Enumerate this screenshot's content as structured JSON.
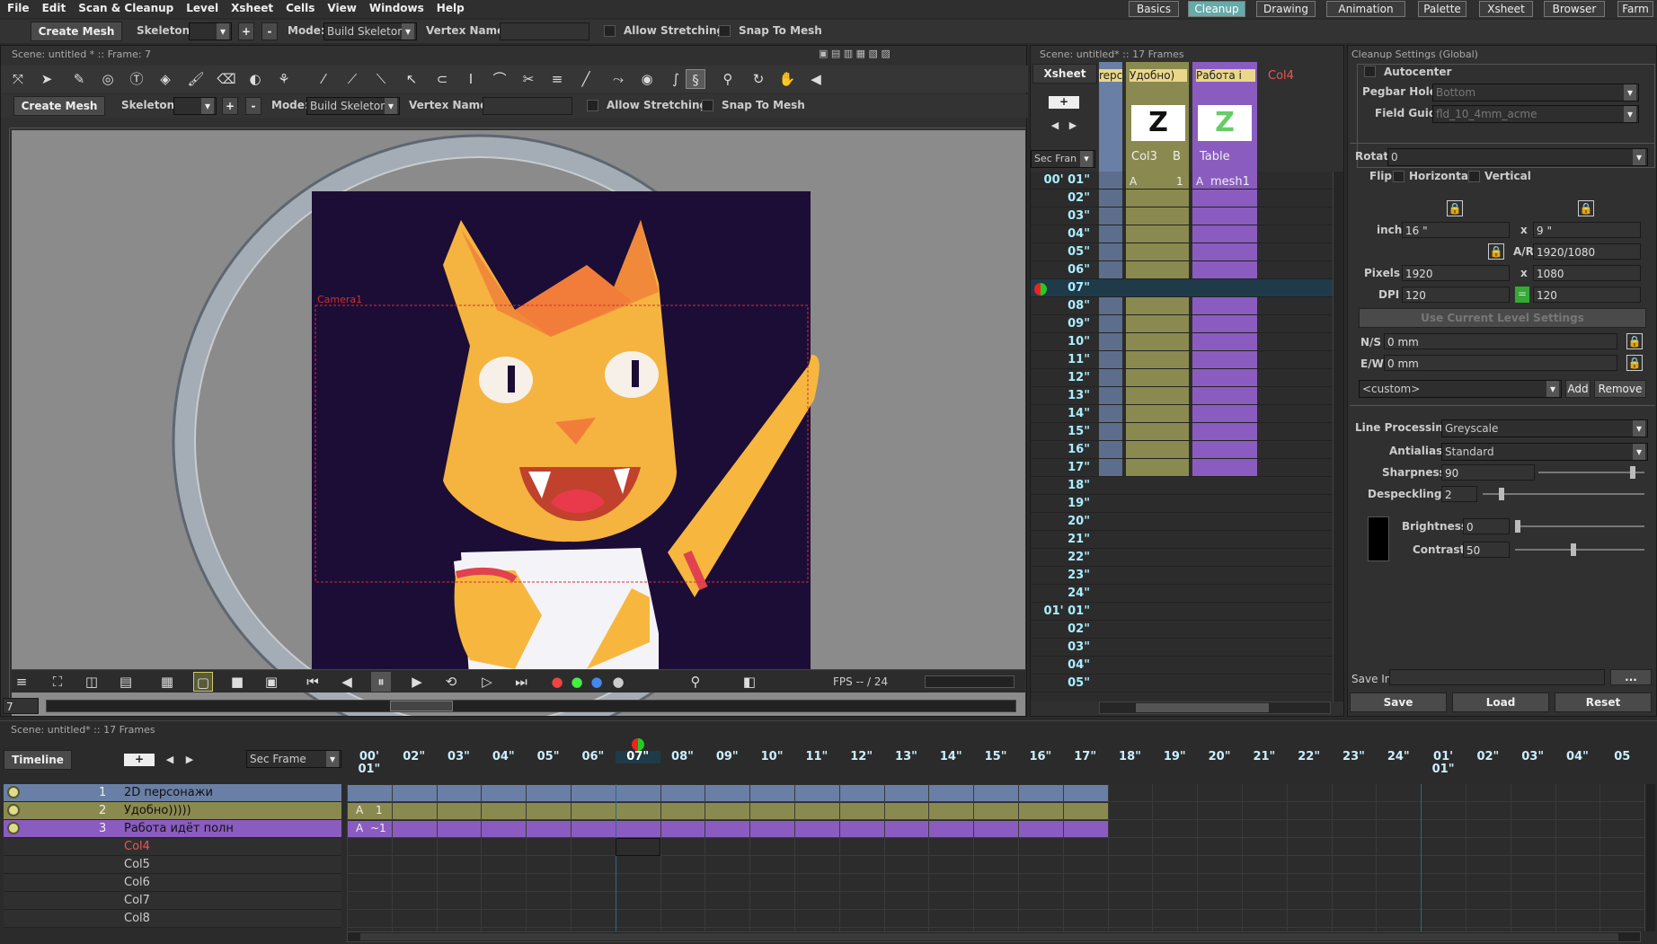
{
  "menu": [
    "File",
    "Edit",
    "Scan & Cleanup",
    "Level",
    "Xsheet",
    "Cells",
    "View",
    "Windows",
    "Help"
  ],
  "rooms": [
    "Basics",
    "Cleanup",
    "Drawing",
    "Animation",
    "Palette",
    "Xsheet",
    "Browser",
    "Farm"
  ],
  "active_room": "Cleanup",
  "top_toolbar": {
    "create_mesh": "Create Mesh",
    "skeleton_label": "Skeleton:",
    "plus": "+",
    "minus": "-",
    "mode_label": "Mode:",
    "mode_value": "Build Skeleton",
    "vertex_label": "Vertex Name:",
    "allow_stretching": "Allow Stretching",
    "snap_to_mesh": "Snap To Mesh"
  },
  "viewer": {
    "title": "Scene: untitled *  ::  Frame: 7",
    "camera_label": "Camera1",
    "frame_field": "7",
    "fps": "FPS -- / 24"
  },
  "xsheet": {
    "title": "Scene: untitled*  ::  17 Frames",
    "tab": "Xsheet",
    "sec_frame": "Sec Fran",
    "col_headers": [
      "repc",
      "Удобно)",
      "Работа i",
      "Col4"
    ],
    "col_names": [
      "Col3",
      "B",
      "Table"
    ],
    "cells": [
      "A",
      "1",
      "A",
      "mesh1"
    ],
    "rows": [
      "01'",
      "02\"",
      "03\"",
      "04\"",
      "05\"",
      "06\"",
      "07\"",
      "08\"",
      "09\"",
      "10\"",
      "11\"",
      "12\"",
      "13\"",
      "14\"",
      "15\"",
      "16\"",
      "17\"",
      "18\"",
      "19\"",
      "20\"",
      "21\"",
      "22\"",
      "23\"",
      "24\"",
      "01'",
      "02\"",
      "03\"",
      "04\"",
      "05\""
    ],
    "sec_markers": [
      "00' 01\"",
      "01' 01\""
    ]
  },
  "cleanup": {
    "title": "Cleanup Settings (Global)",
    "autocenter": "Autocenter",
    "pegbar_label": "Pegbar Holes",
    "pegbar_value": "Bottom",
    "field_guide_label": "Field Guide",
    "field_guide_value": "fld_10_4mm_acme",
    "rotate_label": "Rotate",
    "rotate_value": "0",
    "flip_label": "Flip",
    "horizontal": "Horizontal",
    "vertical": "Vertical",
    "inch_label": "inch",
    "inch_w": "16 \"",
    "inch_h": "9 \"",
    "x": "x",
    "ar_label": "A/R",
    "ar_value": "1920/1080",
    "pixels_label": "Pixels",
    "pixels_w": "1920",
    "pixels_h": "1080",
    "dpi_label": "DPI",
    "dpi_w": "120",
    "dpi_h": "120",
    "use_current": "Use Current Level Settings",
    "ns_label": "N/S",
    "ns_value": "0 mm",
    "ew_label": "E/W",
    "ew_value": "0 mm",
    "preset": "<custom>",
    "add": "Add",
    "remove": "Remove",
    "line_processing_label": "Line Processing:",
    "line_processing": "Greyscale",
    "antialias_label": "Antialias:",
    "antialias": "Standard",
    "sharpness_label": "Sharpness:",
    "sharpness": "90",
    "despeckling_label": "Despeckling:",
    "despeckling": "2",
    "brightness_label": "Brightness:",
    "brightness": "0",
    "contrast_label": "Contrast:",
    "contrast": "50",
    "save_in_label": "Save In",
    "browse": "...",
    "save": "Save",
    "load": "Load",
    "reset": "Reset"
  },
  "timeline": {
    "title": "Scene: untitled*  ::  17 Frames",
    "tab": "Timeline",
    "sec_frame": "Sec Frame",
    "layers": [
      {
        "num": "1",
        "name": "2D персонажи"
      },
      {
        "num": "2",
        "name": "Удобно)))))"
      },
      {
        "num": "3",
        "name": "Работа идёт полн"
      },
      {
        "num": "",
        "name": "Col4"
      },
      {
        "num": "",
        "name": "Col5"
      },
      {
        "num": "",
        "name": "Col6"
      },
      {
        "num": "",
        "name": "Col7"
      },
      {
        "num": "",
        "name": "Col8"
      }
    ],
    "frames": [
      "00'\n01\"",
      "02\"",
      "03\"",
      "04\"",
      "05\"",
      "06\"",
      "07\"",
      "08\"",
      "09\"",
      "10\"",
      "11\"",
      "12\"",
      "13\"",
      "14\"",
      "15\"",
      "16\"",
      "17\"",
      "18\"",
      "19\"",
      "20\"",
      "21\"",
      "22\"",
      "23\"",
      "24\"",
      "01'\n01\"",
      "02\"",
      "03\"",
      "04\"",
      "05"
    ],
    "cells": [
      "A",
      "1",
      "A",
      "~1"
    ]
  },
  "colors": {
    "accent": "#6aa8a8",
    "layer1": "#6a7fa5",
    "layer2": "#8a8a50",
    "layer3": "#8a5cc0",
    "canvas_bg": "#1e0f3a",
    "cat": "#f5b340"
  }
}
